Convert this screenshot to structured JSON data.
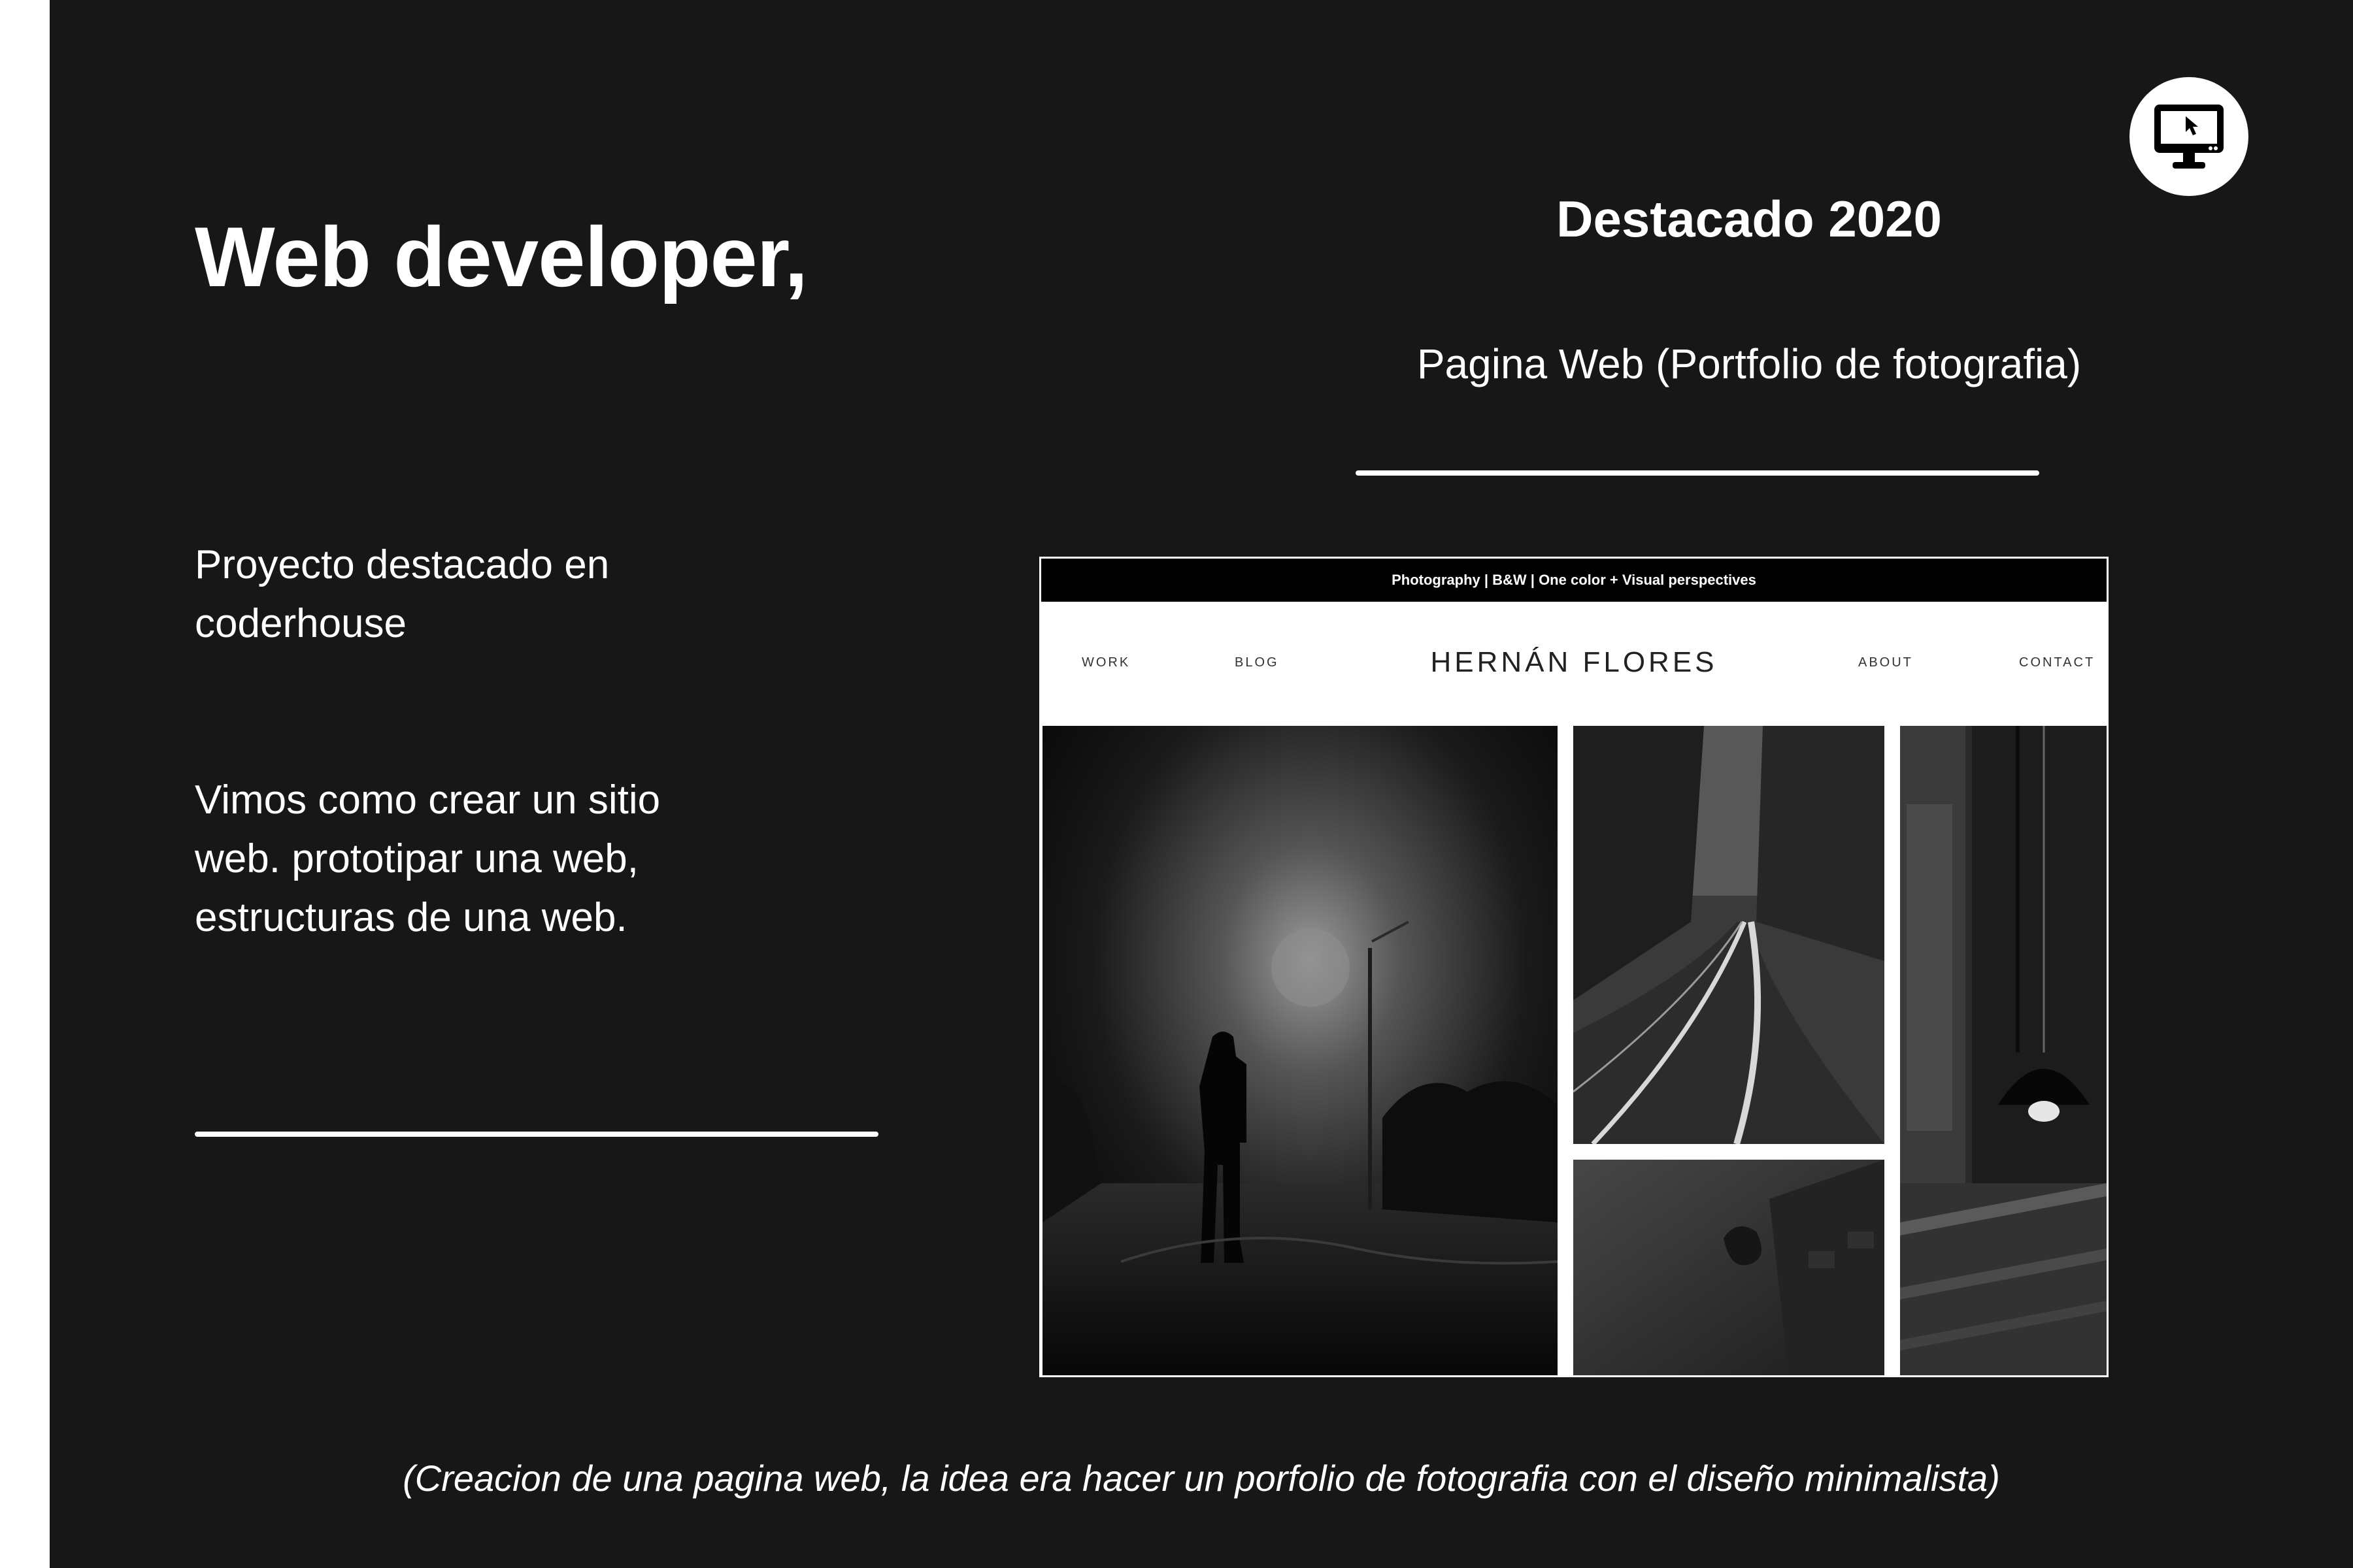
{
  "left": {
    "title": "Web developer,",
    "paragraph_1": [
      "Proyecto destacado en",
      "coderhouse"
    ],
    "paragraph_2": [
      "Vimos como crear un sitio",
      "web. prototipar una web,",
      "estructuras de una web."
    ]
  },
  "right": {
    "heading": "Destacado 2020",
    "subtitle": "Pagina Web (Portfolio de fotografia)"
  },
  "mockup": {
    "top_bar": "Photography | B&W | One color + Visual perspectives",
    "nav": {
      "work": "WORK",
      "blog": "BLOG",
      "brand": "HERNÁN FLORES",
      "about": "ABOUT",
      "contact": "CONTACT"
    }
  },
  "caption": "(Creacion de una pagina web, la idea era hacer un porfolio de fotografia con el diseño minimalista)",
  "icons": {
    "corner": "monitor-cursor-icon"
  },
  "colors": {
    "background": "#171717",
    "text": "#ffffff",
    "icon_bg": "#ffffff"
  }
}
